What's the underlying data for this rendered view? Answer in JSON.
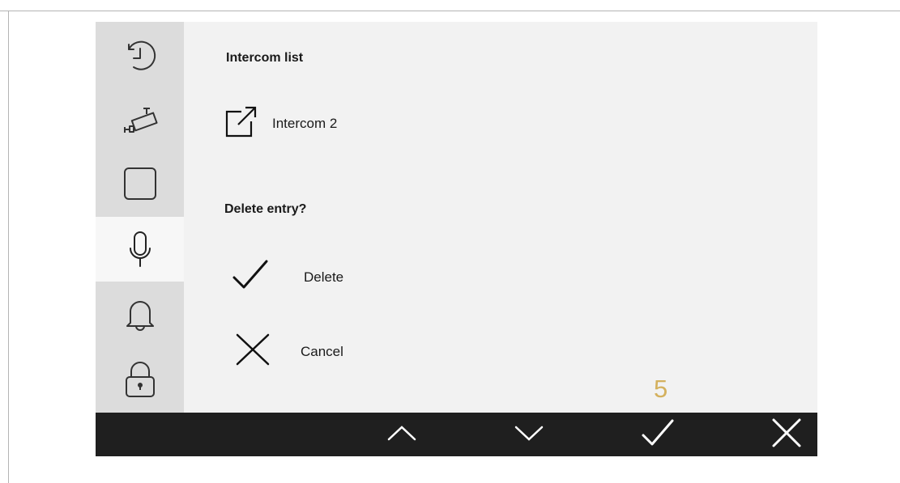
{
  "sidebar": {
    "items": [
      {
        "name": "history",
        "icon": "history-clock-icon",
        "active": false
      },
      {
        "name": "camera",
        "icon": "camera-icon",
        "active": false
      },
      {
        "name": "panel",
        "icon": "square-icon",
        "active": false
      },
      {
        "name": "intercom",
        "icon": "microphone-icon",
        "active": true
      },
      {
        "name": "alarm",
        "icon": "bell-icon",
        "active": false
      },
      {
        "name": "lock",
        "icon": "padlock-icon",
        "active": false
      }
    ]
  },
  "main": {
    "list_title": "Intercom list",
    "entry": {
      "icon": "external-link-icon",
      "label": "Intercom 2"
    },
    "dialog_title": "Delete entry?",
    "options": [
      {
        "icon": "checkmark-icon",
        "label": "Delete"
      },
      {
        "icon": "cross-icon",
        "label": "Cancel"
      }
    ]
  },
  "step_marker": "5",
  "bottom_bar": {
    "buttons": [
      {
        "icon": "chevron-up-icon"
      },
      {
        "icon": "chevron-down-icon"
      },
      {
        "icon": "checkmark-icon"
      },
      {
        "icon": "close-icon"
      }
    ]
  },
  "colors": {
    "accent": "#d4b15e",
    "sidebar_bg": "#dcdcdc",
    "active_bg": "#f7f7f7",
    "content_bg": "#f2f2f2",
    "bar_bg": "#1f1f1f"
  }
}
